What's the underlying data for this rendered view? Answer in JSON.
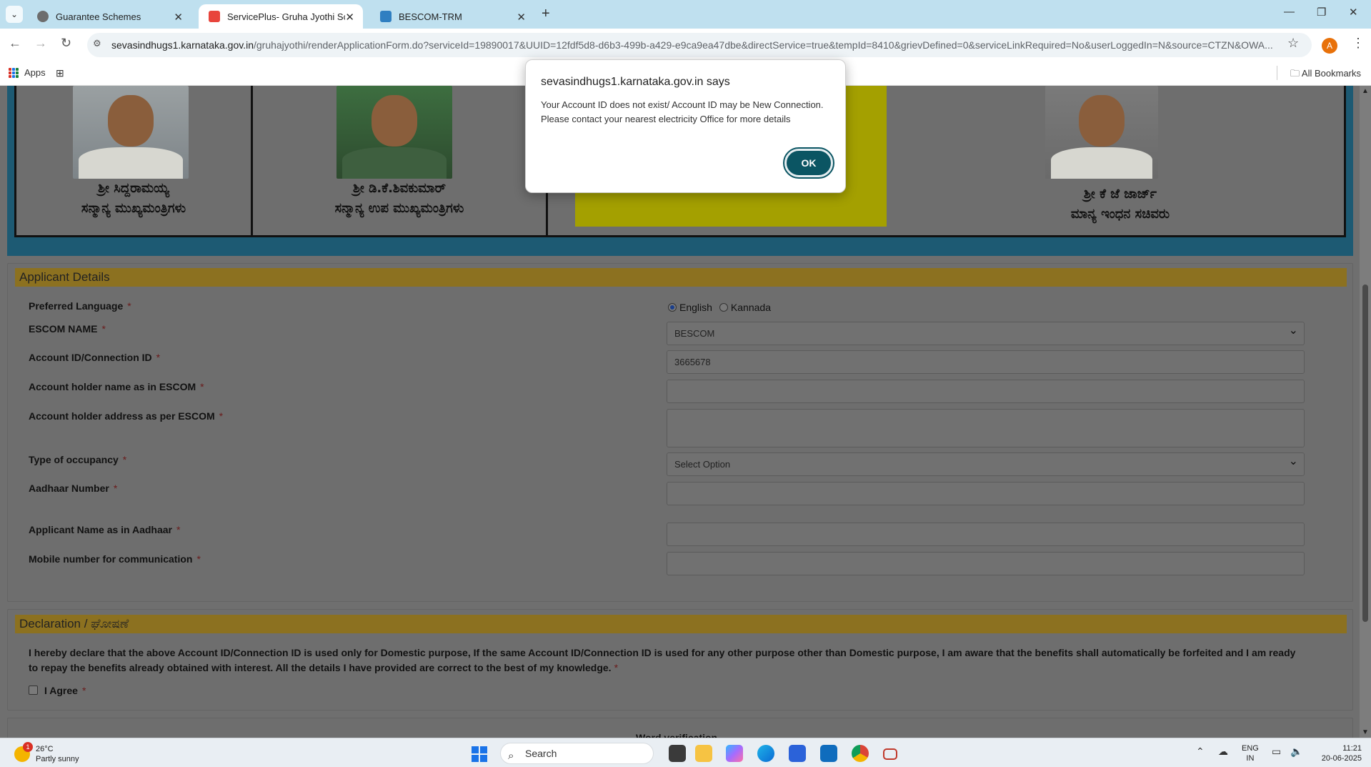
{
  "browser": {
    "tabs": [
      {
        "label": "Guarantee Schemes",
        "active": false
      },
      {
        "label": "ServicePlus- Gruha Jyothi Scheme",
        "active": true
      },
      {
        "label": "BESCOM-TRM",
        "active": false
      }
    ],
    "url_host": "sevasindhugs1.karnataka.gov.in",
    "url_path": "/gruhajyothi/renderApplicationForm.do?serviceId=19890017&UUID=12fdf5d8-d6b3-499b-a429-e9ca9ea47dbe&directService=true&tempId=8410&grievDefined=0&serviceLinkRequired=No&userLoggedIn=N&source=CTZN&OWA...",
    "profile_initial": "A",
    "bookmarks": {
      "apps": "Apps",
      "all_bookmarks": "All Bookmarks"
    }
  },
  "banner": {
    "leaders": [
      {
        "name": "ಶ್ರೀ ಸಿದ್ದರಾಮಯ್ಯ",
        "title": "ಸನ್ಮಾನ್ಯ ಮುಖ್ಯಮಂತ್ರಿಗಳು"
      },
      {
        "name": "ಶ್ರೀ ಡಿ.ಕೆ.ಶಿವಕುಮಾರ್",
        "title": "ಸನ್ಮಾನ್ಯ ಉಪ ಮುಖ್ಯಮಂತ್ರಿಗಳು"
      },
      {
        "name": "ಶ್ರೀ ಕೆ ಜೆ ಜಾರ್ಜ್",
        "title": "ಮಾನ್ಯ ಇಂಧನ ಸಚಿವರು"
      }
    ]
  },
  "applicant": {
    "heading": "Applicant Details",
    "preferred_language": {
      "label": "Preferred Language",
      "options": [
        "English",
        "Kannada"
      ],
      "selected": "English"
    },
    "escom": {
      "label": "ESCOM NAME",
      "value": "BESCOM"
    },
    "account_id": {
      "label": "Account ID/Connection ID",
      "value": "3665678"
    },
    "holder_name": {
      "label": "Account holder name as in ESCOM",
      "value": ""
    },
    "holder_address": {
      "label": "Account holder address as per ESCOM",
      "value": ""
    },
    "occupancy": {
      "label": "Type of occupancy",
      "value": "Select Option"
    },
    "aadhaar": {
      "label": "Aadhaar Number",
      "value": ""
    },
    "aadhaar_name": {
      "label": "Applicant Name as in Aadhaar",
      "value": ""
    },
    "mobile": {
      "label": "Mobile number for communication",
      "value": ""
    },
    "required_mark": "*"
  },
  "declaration": {
    "heading": "Declaration / ಘೋಷಣೆ",
    "text": "I hereby declare that the above Account ID/Connection ID is used only for Domestic purpose, If the same Account ID/Connection ID is used for any other purpose other than Domestic purpose, I am aware that the benefits shall automatically be forfeited and I am ready to repay the benefits already obtained with interest. All the details I have provided are correct to the best of my knowledge.",
    "agree_label": "I Agree",
    "agree_checked": false
  },
  "next_section_partial": "Word verification",
  "dialog": {
    "title": "sevasindhugs1.karnataka.gov.in says",
    "message": "Your Account ID does not exist/ Account ID may be New Connection. Please contact your nearest electricity Office for more details",
    "ok_label": "OK"
  },
  "taskbar": {
    "weather_temp": "26°C",
    "weather_desc": "Partly sunny",
    "weather_badge": "1",
    "search_placeholder": "Search",
    "lang_line1": "ENG",
    "lang_line2": "IN",
    "time": "11:21",
    "date": "20-06-2025"
  },
  "colors": {
    "section_header": "#8c7120",
    "banner_border": "#1d5a73",
    "dialog_button": "#0b5563"
  }
}
